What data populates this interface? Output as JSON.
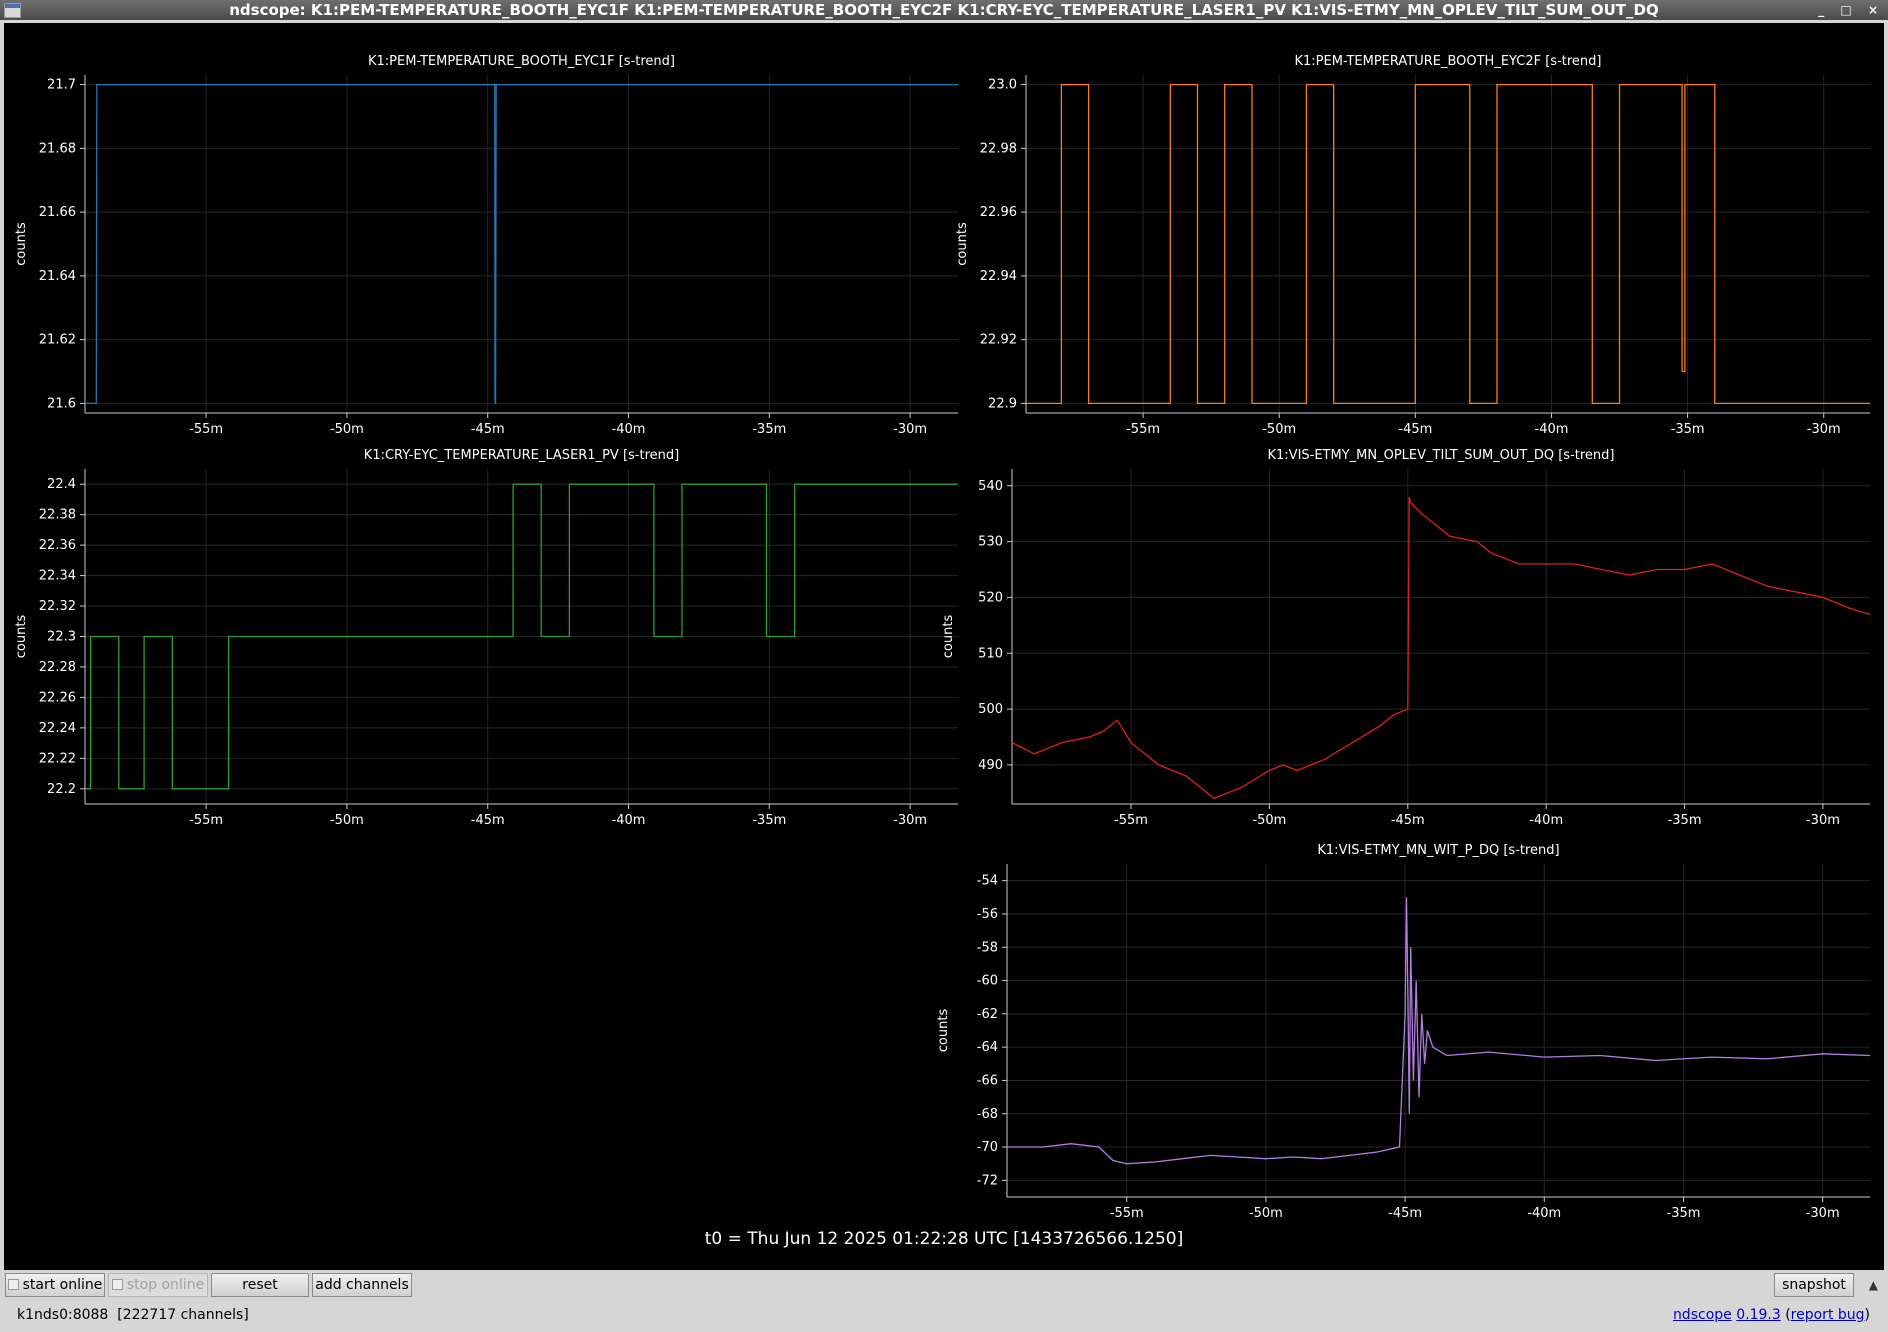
{
  "window": {
    "title": "ndscope: K1:PEM-TEMPERATURE_BOOTH_EYC1F K1:PEM-TEMPERATURE_BOOTH_EYC2F K1:CRY-EYC_TEMPERATURE_LASER1_PV K1:VIS-ETMY_MN_OPLEV_TILT_SUM_OUT_DQ",
    "controls": [
      "_",
      "□",
      "×"
    ]
  },
  "t0_label": "t0 = Thu Jun 12 2025 01:22:28 UTC [1433726566.1250]",
  "toolbar": {
    "start_online": "start online",
    "stop_online": "stop online",
    "reset": "reset",
    "add_channels": "add channels",
    "snapshot": "snapshot",
    "scroll_icon": "▲"
  },
  "status": {
    "server": "k1nds0:8088",
    "channels": "[222717 channels]",
    "app": "ndscope",
    "version": "0.19.3",
    "report": "report bug"
  },
  "chart_data": [
    {
      "type": "line",
      "title": "K1:PEM-TEMPERATURE_BOOTH_EYC1F [s-trend]",
      "ylabel": "counts",
      "color": "#1f77b4",
      "xlim": [
        -59.3,
        -28.3
      ],
      "ylim": [
        21.597,
        21.703
      ],
      "xticks": [
        {
          "v": -55,
          "label": "-55m"
        },
        {
          "v": -50,
          "label": "-50m"
        },
        {
          "v": -45,
          "label": "-45m"
        },
        {
          "v": -40,
          "label": "-40m"
        },
        {
          "v": -35,
          "label": "-35m"
        },
        {
          "v": -30,
          "label": "-30m"
        }
      ],
      "yticks": [
        {
          "v": 21.6,
          "label": "21.6"
        },
        {
          "v": 21.62,
          "label": "21.62"
        },
        {
          "v": 21.64,
          "label": "21.64"
        },
        {
          "v": 21.66,
          "label": "21.66"
        },
        {
          "v": 21.68,
          "label": "21.68"
        },
        {
          "v": 21.7,
          "label": "21.7"
        }
      ],
      "x": [
        -59.3,
        -58.9,
        -58.88,
        -44.75,
        -44.74,
        -44.72,
        -44.7,
        -28.3
      ],
      "y": [
        21.6,
        21.6,
        21.7,
        21.7,
        21.6,
        21.6,
        21.7,
        21.7
      ]
    },
    {
      "type": "line",
      "title": "K1:PEM-TEMPERATURE_BOOTH_EYC2F [s-trend]",
      "ylabel": "counts",
      "color": "#ff7f0e",
      "xlim": [
        -59.3,
        -28.3
      ],
      "ylim": [
        22.897,
        23.003
      ],
      "xticks": [
        {
          "v": -55,
          "label": "-55m"
        },
        {
          "v": -50,
          "label": "-50m"
        },
        {
          "v": -45,
          "label": "-45m"
        },
        {
          "v": -40,
          "label": "-40m"
        },
        {
          "v": -35,
          "label": "-35m"
        },
        {
          "v": -30,
          "label": "-30m"
        }
      ],
      "yticks": [
        {
          "v": 22.9,
          "label": "22.9"
        },
        {
          "v": 22.92,
          "label": "22.92"
        },
        {
          "v": 22.94,
          "label": "22.94"
        },
        {
          "v": 22.96,
          "label": "22.96"
        },
        {
          "v": 22.98,
          "label": "22.98"
        },
        {
          "v": 23.0,
          "label": "23.0"
        }
      ],
      "x": [
        -59.3,
        -58.0,
        -58.0,
        -57.0,
        -57.0,
        -54.0,
        -54.0,
        -53.0,
        -53.0,
        -52.0,
        -52.0,
        -51.0,
        -51.0,
        -49.0,
        -49.0,
        -48.0,
        -48.0,
        -45.0,
        -45.0,
        -43.0,
        -43.0,
        -42.0,
        -42.0,
        -38.5,
        -38.5,
        -37.5,
        -37.5,
        -35.2,
        -35.2,
        -35.1,
        -35.1,
        -34.0,
        -34.0,
        -28.3
      ],
      "y": [
        22.9,
        22.9,
        23.0,
        23.0,
        22.9,
        22.9,
        23.0,
        23.0,
        22.9,
        22.9,
        23.0,
        23.0,
        22.9,
        22.9,
        23.0,
        23.0,
        22.9,
        22.9,
        23.0,
        23.0,
        22.9,
        22.9,
        23.0,
        23.0,
        22.9,
        22.9,
        23.0,
        23.0,
        22.91,
        22.91,
        23.0,
        23.0,
        22.9,
        22.9
      ]
    },
    {
      "type": "line",
      "title": "K1:CRY-EYC_TEMPERATURE_LASER1_PV [s-trend]",
      "ylabel": "counts",
      "color": "#2ca02c",
      "xlim": [
        -59.3,
        -28.3
      ],
      "ylim": [
        22.19,
        22.41
      ],
      "xticks": [
        {
          "v": -55,
          "label": "-55m"
        },
        {
          "v": -50,
          "label": "-50m"
        },
        {
          "v": -45,
          "label": "-45m"
        },
        {
          "v": -40,
          "label": "-40m"
        },
        {
          "v": -35,
          "label": "-35m"
        },
        {
          "v": -30,
          "label": "-30m"
        }
      ],
      "yticks": [
        {
          "v": 22.2,
          "label": "22.2"
        },
        {
          "v": 22.22,
          "label": "22.22"
        },
        {
          "v": 22.24,
          "label": "22.24"
        },
        {
          "v": 22.26,
          "label": "22.26"
        },
        {
          "v": 22.28,
          "label": "22.28"
        },
        {
          "v": 22.3,
          "label": "22.3"
        },
        {
          "v": 22.32,
          "label": "22.32"
        },
        {
          "v": 22.34,
          "label": "22.34"
        },
        {
          "v": 22.36,
          "label": "22.36"
        },
        {
          "v": 22.38,
          "label": "22.38"
        },
        {
          "v": 22.4,
          "label": "22.4"
        }
      ],
      "x": [
        -59.3,
        -59.1,
        -59.1,
        -58.1,
        -58.1,
        -57.2,
        -57.2,
        -56.2,
        -56.2,
        -54.2,
        -54.2,
        -44.1,
        -44.1,
        -43.1,
        -43.1,
        -42.1,
        -42.1,
        -39.1,
        -39.1,
        -38.1,
        -38.1,
        -35.1,
        -35.1,
        -34.1,
        -34.1,
        -28.3
      ],
      "y": [
        22.2,
        22.2,
        22.3,
        22.3,
        22.2,
        22.2,
        22.3,
        22.3,
        22.2,
        22.2,
        22.3,
        22.3,
        22.4,
        22.4,
        22.3,
        22.3,
        22.4,
        22.4,
        22.3,
        22.3,
        22.4,
        22.4,
        22.3,
        22.3,
        22.4,
        22.4
      ]
    },
    {
      "type": "line",
      "title": "K1:VIS-ETMY_MN_OPLEV_TILT_SUM_OUT_DQ [s-trend]",
      "ylabel": "counts",
      "color": "#e01f1f",
      "xlim": [
        -59.3,
        -28.3
      ],
      "ylim": [
        483,
        543
      ],
      "xticks": [
        {
          "v": -55,
          "label": "-55m"
        },
        {
          "v": -50,
          "label": "-50m"
        },
        {
          "v": -45,
          "label": "-45m"
        },
        {
          "v": -40,
          "label": "-40m"
        },
        {
          "v": -35,
          "label": "-35m"
        },
        {
          "v": -30,
          "label": "-30m"
        }
      ],
      "yticks": [
        {
          "v": 490,
          "label": "490"
        },
        {
          "v": 500,
          "label": "500"
        },
        {
          "v": 510,
          "label": "510"
        },
        {
          "v": 520,
          "label": "520"
        },
        {
          "v": 530,
          "label": "530"
        },
        {
          "v": 540,
          "label": "540"
        }
      ],
      "x": [
        -59.3,
        -58.5,
        -57.5,
        -56.5,
        -56.0,
        -55.5,
        -55.0,
        -54.0,
        -53.0,
        -52.5,
        -52.0,
        -51.0,
        -50.0,
        -49.5,
        -49.0,
        -48.0,
        -47.0,
        -46.0,
        -45.5,
        -45.0,
        -44.95,
        -44.9,
        -44.5,
        -44.0,
        -43.5,
        -42.5,
        -42.0,
        -41.0,
        -40.0,
        -39.0,
        -38.0,
        -37.0,
        -36.0,
        -35.0,
        -34.0,
        -33.0,
        -32.0,
        -31.0,
        -30.0,
        -29.0,
        -28.3
      ],
      "y": [
        494,
        492,
        494,
        495,
        496,
        498,
        494,
        490,
        488,
        486,
        484,
        486,
        489,
        490,
        489,
        491,
        494,
        497,
        499,
        500,
        538,
        537,
        535,
        533,
        531,
        530,
        528,
        526,
        526,
        526,
        525,
        524,
        525,
        525,
        526,
        524,
        522,
        521,
        520,
        518,
        517
      ]
    },
    {
      "type": "line",
      "title": "K1:VIS-ETMY_MN_WIT_P_DQ [s-trend]",
      "ylabel": "counts",
      "color": "#b07fe0",
      "xlim": [
        -59.3,
        -28.3
      ],
      "ylim": [
        -73,
        -53
      ],
      "xticks": [
        {
          "v": -55,
          "label": "-55m"
        },
        {
          "v": -50,
          "label": "-50m"
        },
        {
          "v": -45,
          "label": "-45m"
        },
        {
          "v": -40,
          "label": "-40m"
        },
        {
          "v": -35,
          "label": "-35m"
        },
        {
          "v": -30,
          "label": "-30m"
        }
      ],
      "yticks": [
        {
          "v": -72,
          "label": "-72"
        },
        {
          "v": -70,
          "label": "-70"
        },
        {
          "v": -68,
          "label": "-68"
        },
        {
          "v": -66,
          "label": "-66"
        },
        {
          "v": -64,
          "label": "-64"
        },
        {
          "v": -62,
          "label": "-62"
        },
        {
          "v": -60,
          "label": "-60"
        },
        {
          "v": -58,
          "label": "-58"
        },
        {
          "v": -56,
          "label": "-56"
        },
        {
          "v": -54,
          "label": "-54"
        }
      ],
      "x": [
        -59.3,
        -58.0,
        -57.0,
        -56.0,
        -55.5,
        -55.0,
        -54.0,
        -53.0,
        -52.0,
        -51.0,
        -50.0,
        -49.0,
        -48.0,
        -47.0,
        -46.0,
        -45.2,
        -45.0,
        -44.95,
        -44.9,
        -44.85,
        -44.8,
        -44.7,
        -44.6,
        -44.5,
        -44.4,
        -44.3,
        -44.2,
        -44.0,
        -43.5,
        -42.0,
        -40.0,
        -38.0,
        -36.0,
        -34.0,
        -32.0,
        -30.0,
        -28.3
      ],
      "y": [
        -70,
        -70,
        -69.8,
        -70,
        -70.8,
        -71,
        -70.9,
        -70.7,
        -70.5,
        -70.6,
        -70.7,
        -70.6,
        -70.7,
        -70.5,
        -70.3,
        -70,
        -62,
        -55,
        -61,
        -68,
        -58,
        -66,
        -60,
        -67,
        -62,
        -65,
        -63,
        -64,
        -64.5,
        -64.3,
        -64.6,
        -64.5,
        -64.8,
        -64.6,
        -64.7,
        -64.4,
        -64.5
      ]
    }
  ]
}
